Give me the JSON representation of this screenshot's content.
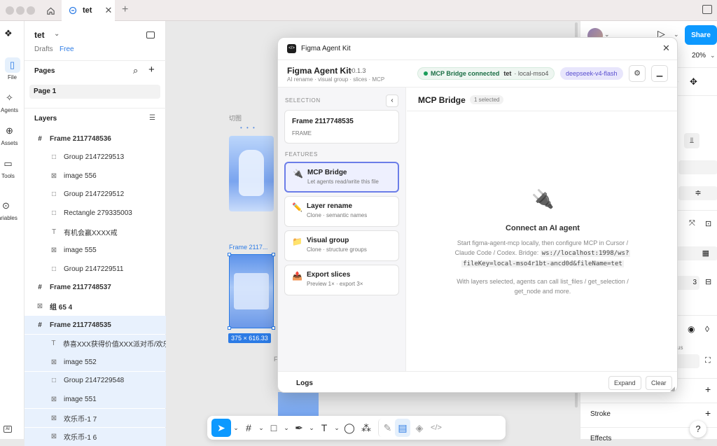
{
  "titlebar": {
    "tab_label": "tet"
  },
  "leftbar": {
    "items": [
      {
        "label": "File",
        "icon": "file-icon"
      },
      {
        "label": "Agents",
        "icon": "agents-icon"
      },
      {
        "label": "Assets",
        "icon": "assets-icon"
      },
      {
        "label": "Tools",
        "icon": "tools-icon"
      },
      {
        "label": "Variables",
        "icon": "variables-icon"
      }
    ]
  },
  "file": {
    "name": "tet",
    "location": "Drafts",
    "plan": "Free"
  },
  "pages": {
    "title": "Pages",
    "items": [
      "Page 1"
    ]
  },
  "layers": {
    "title": "Layers",
    "items": [
      {
        "name": "Frame 2117748536",
        "type": "frame",
        "indent": 0
      },
      {
        "name": "Group 2147229513",
        "type": "group",
        "indent": 1
      },
      {
        "name": "image 556",
        "type": "image",
        "indent": 1
      },
      {
        "name": "Group 2147229512",
        "type": "group",
        "indent": 1
      },
      {
        "name": "Rectangle 279335003",
        "type": "rect",
        "indent": 1
      },
      {
        "name": "有机会赢XXXX戒",
        "type": "text",
        "indent": 1
      },
      {
        "name": "image 555",
        "type": "image",
        "indent": 1
      },
      {
        "name": "Group 2147229511",
        "type": "group",
        "indent": 1
      },
      {
        "name": "Frame 2117748537",
        "type": "frame",
        "indent": 0
      },
      {
        "name": "组 65 4",
        "type": "image",
        "indent": 0
      },
      {
        "name": "Frame 2117748535",
        "type": "frame",
        "indent": 0
      },
      {
        "name": "恭喜XXX获得价值XXX派对币/欢乐豆",
        "type": "text",
        "indent": 1
      },
      {
        "name": "image 552",
        "type": "image",
        "indent": 1
      },
      {
        "name": "Group 2147229548",
        "type": "group",
        "indent": 1
      },
      {
        "name": "image 551",
        "type": "image",
        "indent": 1
      },
      {
        "name": "欢乐币-1 7",
        "type": "image",
        "indent": 1
      },
      {
        "name": "欢乐币-1 6",
        "type": "image",
        "indent": 1
      }
    ]
  },
  "canvas": {
    "label_top": "切图",
    "frame_label": "Frame 2117...",
    "size_badge": "375 × 616.33",
    "partial_label": "F"
  },
  "right": {
    "zoom": "20%",
    "share": "Share",
    "stroke": "Stroke",
    "effects": "Effects",
    "help": "?",
    "value_3": "3",
    "partial_us": "us"
  },
  "modal": {
    "window_title": "Figma Agent Kit",
    "app_name": "Figma Agent Kit",
    "version": "v0.1.3",
    "subtitle": "AI rename · visual group · slices · MCP",
    "status_text": "MCP Bridge connected",
    "status_file": "tet",
    "status_host": "· local-mso4",
    "model": "deepseek-v4-flash",
    "selection_heading": "SELECTION",
    "selection_name": "Frame 2117748535",
    "selection_type": "FRAME",
    "features_heading": "FEATURES",
    "features": [
      {
        "title": "MCP Bridge",
        "subtitle": "Let agents read/write this file",
        "icon": "plug-icon"
      },
      {
        "title": "Layer rename",
        "subtitle": "Clone · semantic names",
        "icon": "pencil-icon"
      },
      {
        "title": "Visual group",
        "subtitle": "Clone · structure groups",
        "icon": "folder-icon"
      },
      {
        "title": "Export slices",
        "subtitle": "Preview 1× · export 3×",
        "icon": "export-icon"
      }
    ],
    "main_title": "MCP Bridge",
    "main_badge": "1 selected",
    "connect_title": "Connect an AI agent",
    "connect_line1": "Start figma-agent-mcp locally, then configure MCP in Cursor /",
    "connect_line2": "Claude Code / Codex. Bridge:",
    "connect_code1": "ws://localhost:1998/ws?",
    "connect_code2": "fileKey=local-mso4r1bt-ancd0d&fileName=tet",
    "connect_line3": "With layers selected, agents can call list_files / get_selection /",
    "connect_line4": "get_node and more.",
    "logs": "Logs",
    "expand": "Expand",
    "clear": "Clear"
  },
  "colors": {
    "accent": "#0d99ff",
    "status_green": "#1a9e5a",
    "model_bg": "#e8e6fc",
    "active_feature": "#6b7de8"
  }
}
